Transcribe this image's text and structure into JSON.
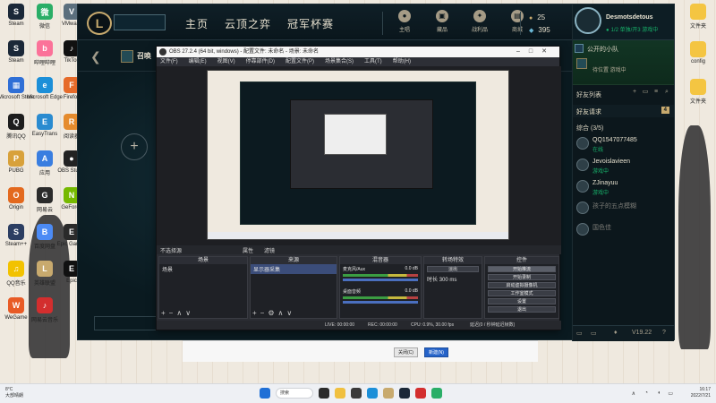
{
  "desktop": {
    "left_icons": [
      {
        "label": "Steam",
        "color": "#1b2838",
        "glyph": "S"
      },
      {
        "label": "微信",
        "color": "#2aae67",
        "glyph": "微"
      },
      {
        "label": "VMware",
        "color": "#5b6f7d",
        "glyph": "V"
      },
      {
        "label": "Steam",
        "color": "#1b2838",
        "glyph": "S"
      },
      {
        "label": "哔哩哔哩",
        "color": "#fb7299",
        "glyph": "b"
      },
      {
        "label": "TikTok",
        "color": "#111111",
        "glyph": "♪"
      },
      {
        "label": "Microsoft Store",
        "color": "#2f6fd6",
        "glyph": "▦"
      },
      {
        "label": "Microsoft Edge",
        "color": "#1c8fd8",
        "glyph": "e"
      },
      {
        "label": "Firefox",
        "color": "#e66b2a",
        "glyph": "F"
      },
      {
        "label": "腾讯QQ",
        "color": "#1d1d1d",
        "glyph": "Q"
      },
      {
        "label": "EasyTrans",
        "color": "#2a8bd0",
        "glyph": "E"
      },
      {
        "label": "阅读器",
        "color": "#e58b2d",
        "glyph": "R"
      },
      {
        "label": "PUBG",
        "color": "#d8a13a",
        "glyph": "P"
      },
      {
        "label": "应用",
        "color": "#3a7ee0",
        "glyph": "A"
      },
      {
        "label": "OBS Studio",
        "color": "#222222",
        "glyph": "●"
      },
      {
        "label": "Origin",
        "color": "#e3691e",
        "glyph": "O"
      },
      {
        "label": "网易云",
        "color": "#2b2b2b",
        "glyph": "G"
      },
      {
        "label": "GeForce",
        "color": "#76b900",
        "glyph": "N"
      },
      {
        "label": "Steam++",
        "color": "#2c3e62",
        "glyph": "S"
      },
      {
        "label": "百度网盘",
        "color": "#4c8bf5",
        "glyph": "B"
      },
      {
        "label": "Epic Games",
        "color": "#2a2a2a",
        "glyph": "E"
      },
      {
        "label": "QQ音乐",
        "color": "#f2c200",
        "glyph": "♫"
      },
      {
        "label": "英雄联盟",
        "color": "#c8aa6e",
        "glyph": "L"
      },
      {
        "label": "Epic",
        "color": "#111111",
        "glyph": "E"
      },
      {
        "label": "WeGame",
        "color": "#e85b26",
        "glyph": "W"
      },
      {
        "label": "网易云音乐",
        "color": "#d32e2e",
        "glyph": "♪"
      }
    ],
    "right_icons": [
      {
        "label": "文件夹",
        "color": "#f4c542"
      },
      {
        "label": "config",
        "color": "#f4c542"
      },
      {
        "label": "文件夹",
        "color": "#f4c542"
      }
    ]
  },
  "lol": {
    "logo": "L",
    "nav": [
      "主页",
      "云顶之弈",
      "冠军杯赛"
    ],
    "top_buttons": [
      {
        "label": "主唱",
        "icon": "profile-icon"
      },
      {
        "label": "藏品",
        "icon": "collection-icon"
      },
      {
        "label": "战利品",
        "icon": "loot-icon"
      },
      {
        "label": "商城",
        "icon": "store-icon"
      }
    ],
    "currency": {
      "blue_essence": "25",
      "rp": "395"
    },
    "sub_title": "召唤",
    "social": {
      "summoner": "Desmotsdetous",
      "status": "1/2 单独/开3 游戏中",
      "party_title": "公开的小队",
      "party_status": "待位置 游戏中",
      "friends_list_title": "好友列表",
      "friend_requests_label": "好友请求",
      "friend_requests_count": "4",
      "group_label": "综合 (3/5)",
      "friends": [
        {
          "name": "QQ1547077485",
          "status": "在线",
          "online": true
        },
        {
          "name": "Jevoislavieen",
          "status": "游戏中",
          "online": true
        },
        {
          "name": "ZJinayuu",
          "status": "游戏中",
          "online": true
        },
        {
          "name": "孩子的五点模糊",
          "status": "",
          "online": false
        },
        {
          "name": "国色佳",
          "status": "",
          "online": false
        }
      ],
      "footer_version": "V19.22"
    }
  },
  "obs": {
    "title": "OBS 27.2.4 (64 bit, windows) - 配置文件: 未命名 - 场景: 未命名",
    "menu": [
      "文件(F)",
      "编辑(E)",
      "视图(V)",
      "停靠部件(D)",
      "配置文件(P)",
      "场景集合(S)",
      "工具(T)",
      "帮助(H)"
    ],
    "scene_bar_left": "不选择源",
    "scene_bar_props": "属性",
    "scene_bar_filters": "滤镜",
    "docks": {
      "scenes_title": "场景",
      "scenes": [
        "场景"
      ],
      "sources_title": "来源",
      "sources": [
        "显示器采集"
      ],
      "mixer_title": "混音器",
      "mixer": [
        {
          "name": "麦克风/Aux",
          "level": "0.0 dB"
        },
        {
          "name": "桌面音频",
          "level": "0.0 dB"
        }
      ],
      "transitions_title": "转场特效",
      "transition": "淡出",
      "duration_label": "时长",
      "duration": "300 ms",
      "controls_title": "控件",
      "controls": [
        "开始推流",
        "开始录制",
        "启动虚拟摄像机",
        "工作室模式",
        "设置",
        "退出"
      ]
    },
    "status": {
      "live": "LIVE: 00:00:00",
      "rec": "REC: 00:00:00",
      "cpu": "CPU: 0.9%, 30.00 fps",
      "dropped": "延迟(0 / 秒钟延迟帧数)"
    }
  },
  "dialog": {
    "cancel": "关闭(C)",
    "confirm": "新建(N)"
  },
  "taskbar": {
    "weather_temp": "8°C",
    "weather_desc": "大部晴朗",
    "search": "搜索",
    "time": "16:17",
    "date": "2022/7/21"
  }
}
